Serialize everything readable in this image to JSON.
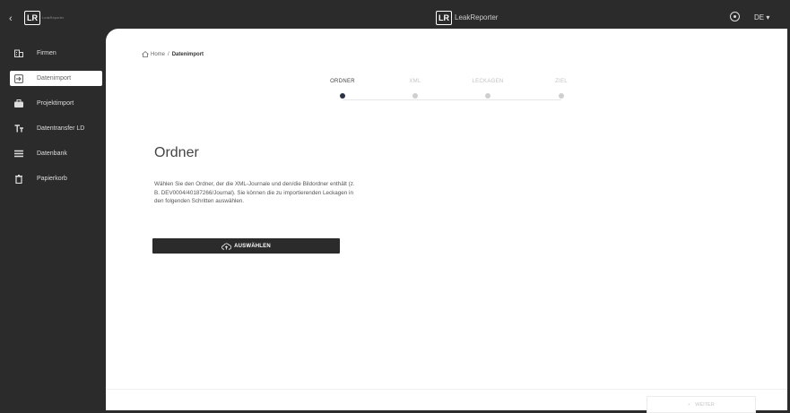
{
  "app": {
    "logo": "LR",
    "logo_sub": "LeakReporter",
    "title": "LeakReporter",
    "language": "DE ▾",
    "back": "‹"
  },
  "sidebar": {
    "items": [
      {
        "label": "Firmen",
        "icon": "building-icon",
        "active": false
      },
      {
        "label": "Datenimport",
        "icon": "import-icon",
        "active": true
      },
      {
        "label": "Projektimport",
        "icon": "briefcase-icon",
        "active": false
      },
      {
        "label": "Datentransfer LD",
        "icon": "text-transfer-icon",
        "active": false
      },
      {
        "label": "Datenbank",
        "icon": "list-icon",
        "active": false
      },
      {
        "label": "Papierkorb",
        "icon": "trash-icon",
        "active": false
      }
    ]
  },
  "breadcrumb": {
    "home": "Home",
    "separator": "/",
    "current": "Datenimport"
  },
  "stepper": {
    "steps": [
      {
        "label": "ORDNER",
        "active": true
      },
      {
        "label": "XML",
        "active": false
      },
      {
        "label": "LECKAGEN",
        "active": false
      },
      {
        "label": "ZIEL",
        "active": false
      }
    ]
  },
  "main": {
    "title": "Ordner",
    "description": "Wählen Sie den Ordner, der die XML-Journale und den/die Bildordner enthält (z. B. DEV0004/40187266/Journal). Sie können die zu importierenden Leckagen in den folgenden Schritten auswählen.",
    "select_button": "AUSWÄHLEN"
  },
  "footer": {
    "next_button": "WEITER",
    "next_icon": "›"
  },
  "colors": {
    "chrome": "#2b2b2b",
    "active_step": "#2c3246",
    "inactive_step": "#cfcfcf"
  }
}
